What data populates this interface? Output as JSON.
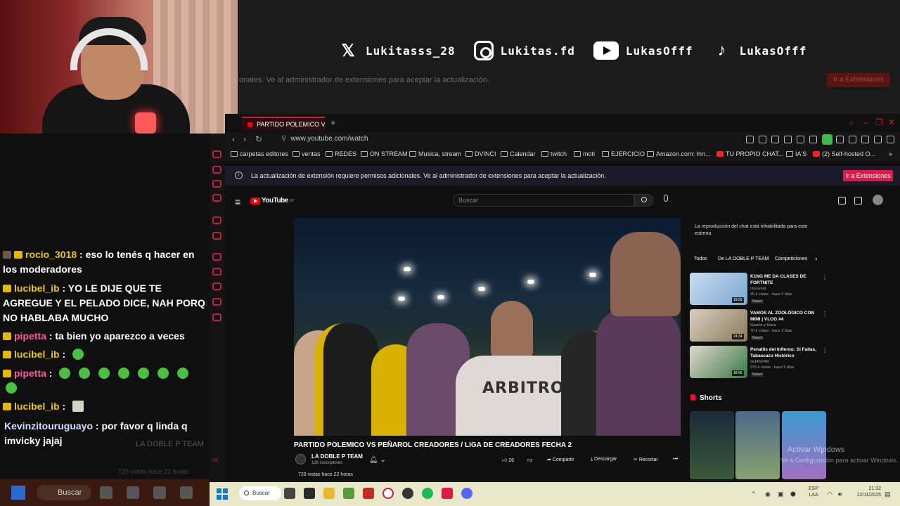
{
  "socials": [
    {
      "icon": "x-icon",
      "handle": "Lukitasss_28"
    },
    {
      "icon": "instagram-icon",
      "handle": "Lukitas.fd"
    },
    {
      "icon": "youtube-icon",
      "handle": "LukasOfff"
    },
    {
      "icon": "tiktok-icon",
      "handle": "LukasOfff"
    }
  ],
  "chat": {
    "messages": [
      {
        "user": "rocio_3018",
        "text": " : eso lo tenés q hacer en los moderadores"
      },
      {
        "user": "lucibel_ib",
        "text": " : YO LE DIJE QUE TE AGREGUE Y EL PELADO DICE, NAH PORQ NO HABLABA MUCHO"
      },
      {
        "user": "pipetta",
        "text": " : ta bien yo aparezco a veces"
      },
      {
        "user": "lucibel_ib",
        "text": " : "
      },
      {
        "user": "pipetta",
        "text": " : "
      },
      {
        "user": "lucibel_ib",
        "text": " : "
      },
      {
        "user": "Kevinzitouruguayo",
        "text": " : por favor q linda q imvicky jajaj"
      }
    ],
    "ghost_channel": "LA DOBLE P TEAM",
    "ghost_views": "729 vistas   hace 22 horas"
  },
  "browser": {
    "tab_title": "PARTIDO POLEMICO VS P",
    "url": "www.youtube.com/watch",
    "bookmarks": [
      "carpetas editores",
      "ventas",
      "REDES",
      "ON STREAM",
      "Musica, stream",
      "DVINCI",
      "Calendar",
      "twitch",
      "moti",
      "EJERCICIO",
      "Amazon.com: Inn...",
      "TU PROPIO CHAT...",
      "IA'S",
      "(2) Self-hosted O..."
    ],
    "notice": "La actualización de extensión requiere permisos adicionales. Ve al administrador de extensiones para aceptar la actualización.",
    "notice_faded": "onales. Ve al administrador de extensiones para aceptar la actualización.",
    "notice_button": "Ir a Extensiones"
  },
  "youtube": {
    "logo": "YouTube",
    "logo_country": "UY",
    "search_placeholder": "Buscar",
    "video_title": "PARTIDO POLEMICO VS PEÑAROL CREADORES / LIGA DE CREADORES FECHA 2",
    "shirt_text": "ARBITROS",
    "channel": {
      "name": "LA DOBLE P TEAM",
      "subs": "128 suscriptores"
    },
    "likes": "26",
    "actions": {
      "share": "Compartir",
      "download": "Descargar",
      "clip": "Recortar"
    },
    "views": "729 vistas   hace 22 horas",
    "chat_disabled": "La reproducción del chat está inhabilitada para este estreno.",
    "chips": [
      "Todos",
      "De LA DOBLE P TEAM",
      "Competiciones"
    ],
    "recommendations": [
      {
        "title": "K1NG ME DA CLASES DE FORTNITE",
        "channel": "Oscurlod",
        "meta": "46 k vistas · hace 3 días",
        "badge": "Nuevo",
        "duration": "19:05"
      },
      {
        "title": "VAMOS AL ZOOLÓGICO CON MIMI | VLOG #4",
        "channel": "Gaston y Kiara",
        "meta": "70 k vistas · hace 2 días",
        "badge": "Nuevo",
        "duration": "24:34"
      },
      {
        "title": "Penaltis del Infierno: Si Fallas, Tabascazo Histórico",
        "channel": "GUANYAR",
        "meta": "375 k vistas · hace 5 días",
        "badge": "Nuevo",
        "duration": "18:59"
      }
    ],
    "shorts_label": "Shorts",
    "activate_title": "Activar Windows",
    "activate_sub": "Ve a Configuración para activar Windows."
  },
  "taskbar": {
    "search": "Buscar",
    "lang": [
      "ESP",
      "LAA"
    ],
    "time": "21:32",
    "date": "12/11/2025"
  },
  "colors": {
    "accent": "#c81e3a",
    "yt_red": "#ff0000",
    "chat_gold": "#e8c800",
    "chat_pink": "#ff5aa0"
  }
}
